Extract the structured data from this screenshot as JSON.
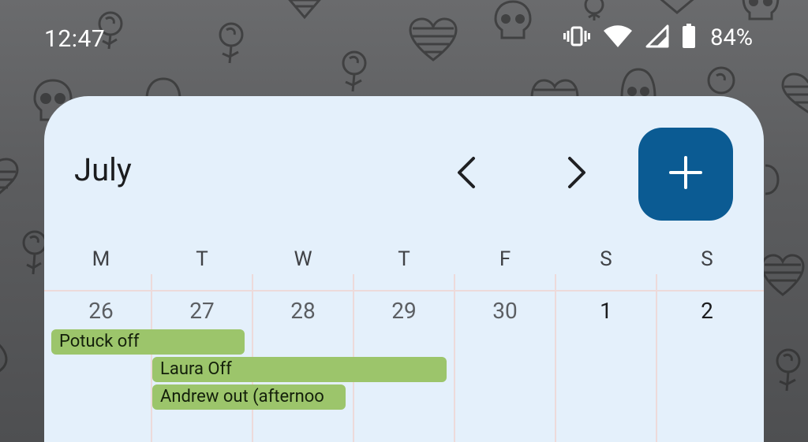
{
  "status_bar": {
    "time": "12:47",
    "battery_percent": "84%",
    "icons": [
      "vibrate-icon",
      "wifi-icon",
      "cell-signal-icon",
      "battery-icon"
    ]
  },
  "widget": {
    "month": "July",
    "weekdays": [
      "M",
      "T",
      "W",
      "T",
      "F",
      "S",
      "S"
    ],
    "dates": [
      "26",
      "27",
      "28",
      "29",
      "30",
      "1",
      "2"
    ],
    "events": [
      {
        "title": "Potuck off"
      },
      {
        "title": "Laura Off"
      },
      {
        "title": "Andrew out (afternoo"
      }
    ]
  },
  "colors": {
    "widget_bg": "#e4f0fb",
    "accent": "#0b5b93",
    "event_green": "#9cc56b",
    "grid_line": "#eddada"
  }
}
